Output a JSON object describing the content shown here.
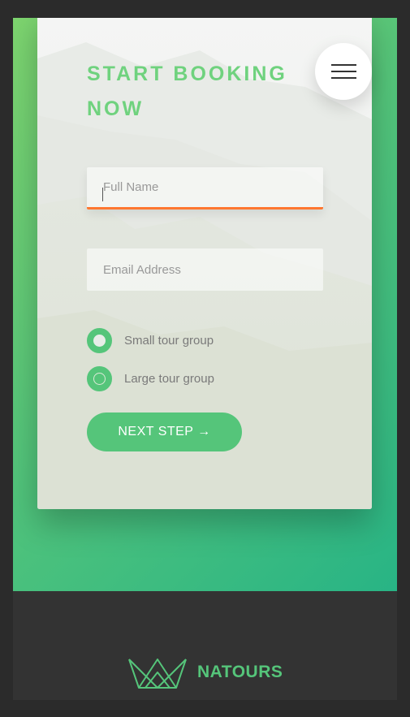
{
  "booking": {
    "title": "START BOOKING NOW",
    "name_placeholder": "Full Name",
    "email_placeholder": "Email Address",
    "radios": [
      {
        "label": "Small tour group"
      },
      {
        "label": "Large tour group"
      }
    ],
    "next_button": "NEXT STEP →"
  },
  "navigation": {
    "menu_icon": "hamburger-icon"
  },
  "footer": {
    "logo_icon": "crown-logo-icon",
    "brand": "NATOURS"
  },
  "colors": {
    "primary_green": "#55c57a",
    "light_green": "#7ed56f",
    "dark_green": "#28b485",
    "focus_orange": "#ff7730",
    "footer_dark": "#333333"
  }
}
